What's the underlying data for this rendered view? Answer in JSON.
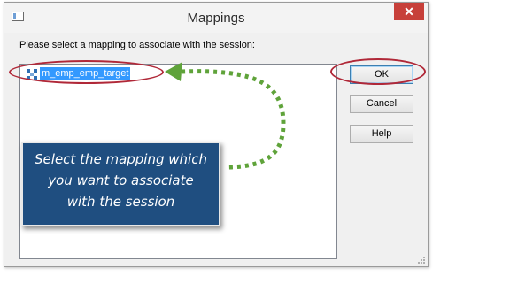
{
  "window": {
    "title": "Mappings",
    "close_glyph": "✕"
  },
  "prompt": "Please select a mapping to associate with the session:",
  "mappings": [
    {
      "label": "m_emp_emp_target",
      "icon": "mapping-icon",
      "selected": true
    }
  ],
  "buttons": {
    "ok": "OK",
    "cancel": "Cancel",
    "help": "Help"
  },
  "annotation": {
    "lines": [
      "Select the mapping which",
      "you want to associate",
      "with the session"
    ],
    "highlight_color": "#b02838",
    "arrow_color": "#5fa33a",
    "callout_color": "#1f4e80"
  }
}
